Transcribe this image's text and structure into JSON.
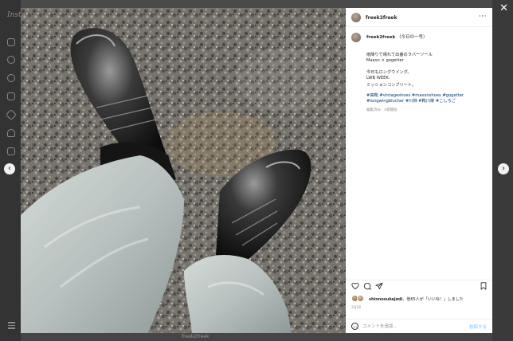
{
  "background": {
    "logo_text": "Inst",
    "caption_text": "freek2freek"
  },
  "modal": {
    "close_icon": "close-icon",
    "prev_icon": "chevron-left-icon",
    "next_icon": "chevron-right-icon"
  },
  "post": {
    "username": "freek2freek",
    "more_icon": "···",
    "caption": {
      "username": "freek2freek",
      "title": "（今日の一号）",
      "lines": [
        "雨降りて晴れて出番のラバーソール",
        "Mason × gogetter",
        "今日もロングウイング。",
        "LWB WEEK.",
        "ミッションコンプリート。"
      ],
      "hashtags": "#高靴 #vintageshoes #masonshoes #gogetter #longwingblucher #川柳 #靴川柳 #こしろご",
      "meta": "編集済み · 4週間前"
    },
    "likes": {
      "user": "shinnosukejedi",
      "text": "、他65人が「いいね！」しました"
    },
    "date": "2月26",
    "comment": {
      "placeholder": "コメントを追加...",
      "post_label": "投稿する"
    }
  },
  "colors": {
    "link": "#00376b",
    "post_button": "#86c3f7",
    "muted": "#8e8e8e"
  }
}
